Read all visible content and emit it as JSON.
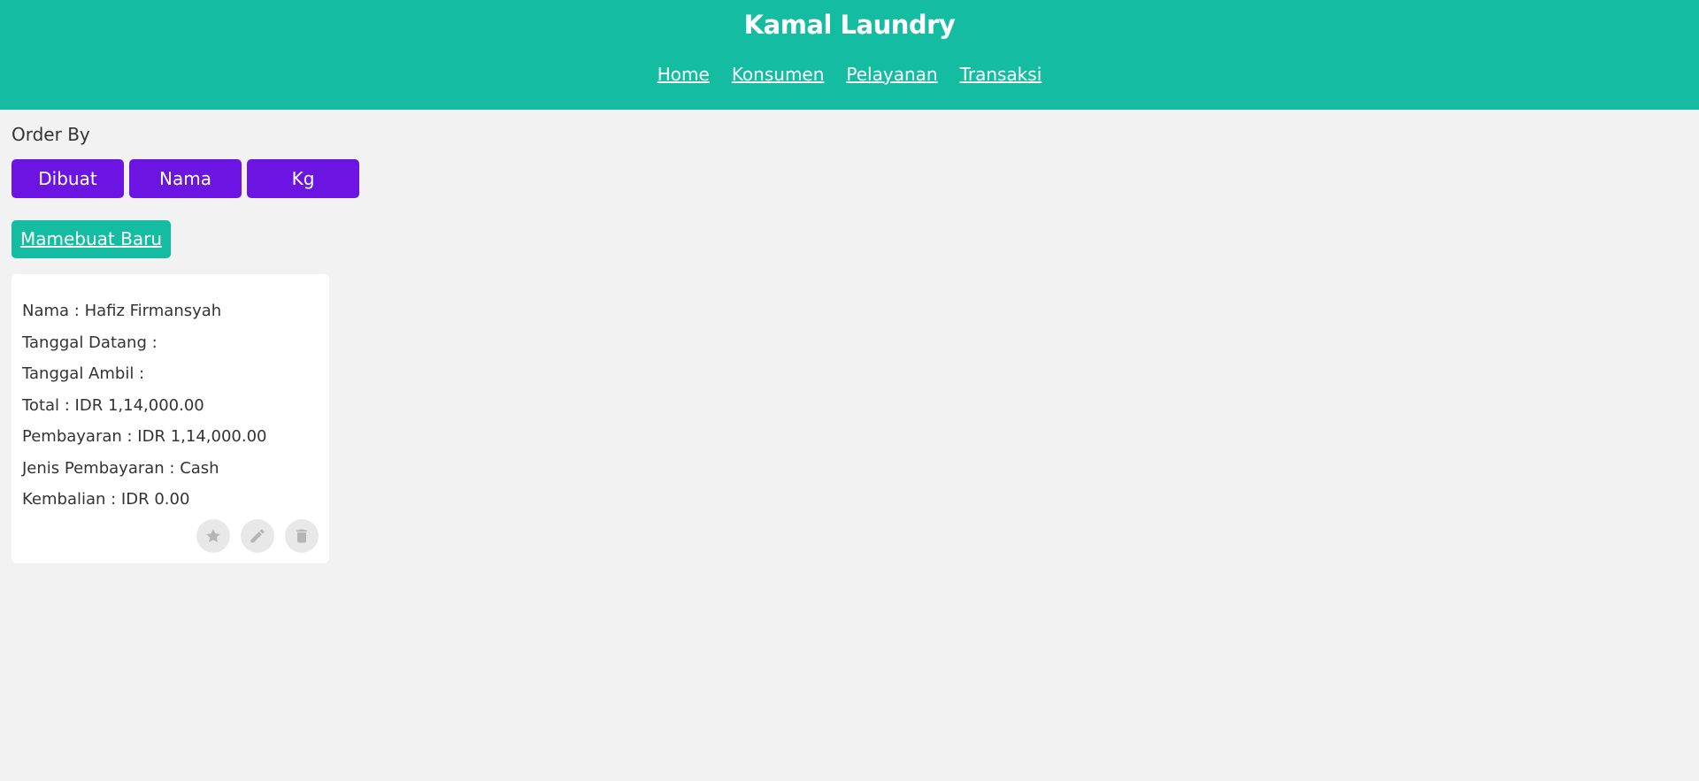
{
  "header": {
    "title": "Kamal Laundry",
    "nav": [
      {
        "label": "Home"
      },
      {
        "label": "Konsumen"
      },
      {
        "label": "Pelayanan"
      },
      {
        "label": "Transaksi"
      }
    ]
  },
  "order_by": {
    "label": "Order By",
    "buttons": [
      {
        "label": "Dibuat"
      },
      {
        "label": "Nama"
      },
      {
        "label": "Kg"
      }
    ]
  },
  "create_button": {
    "label": "Mamebuat Baru"
  },
  "colors": {
    "header_bg": "#14bca2",
    "order_button_bg": "#6c14e2",
    "page_bg": "#f2f2f2"
  },
  "transactions": [
    {
      "lines": [
        "Nama : Hafiz Firmansyah",
        "Tanggal Datang :",
        "Tanggal Ambil :",
        "Total : IDR 1,14,000.00",
        "Pembayaran : IDR 1,14,000.00",
        "Jenis Pembayaran : Cash",
        "Kembalian : IDR 0.00"
      ],
      "actions": [
        {
          "icon": "star-icon"
        },
        {
          "icon": "pencil-icon"
        },
        {
          "icon": "trash-icon"
        }
      ]
    }
  ]
}
